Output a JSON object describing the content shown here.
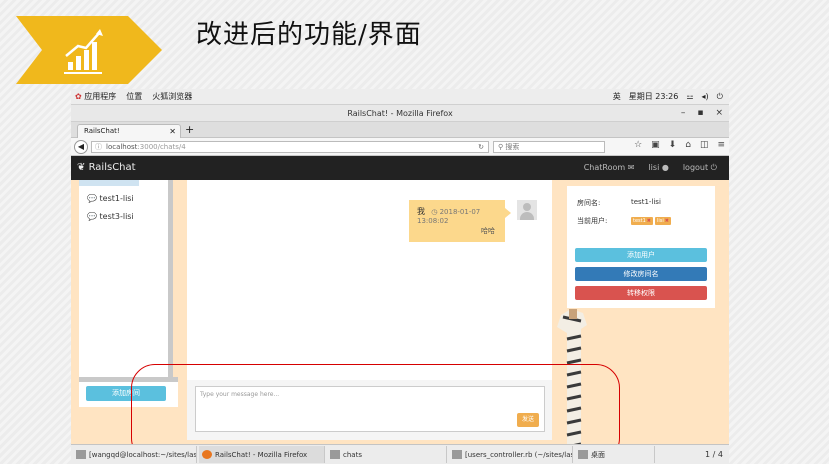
{
  "slide": {
    "title": "改进后的功能/界面",
    "accent_color": "#f0b81c",
    "badge_icon": "bar-chart-growth-icon"
  },
  "gnome_bar": {
    "applications": "应用程序",
    "places": "位置",
    "app_name": "火狐浏览器",
    "ime": "英",
    "clock": "星期日 23:26"
  },
  "browser": {
    "window_title": "RailsChat! - Mozilla Firefox",
    "tab_title": "RailsChat!",
    "url_host": "localhost",
    "url_path": ":3000/chats/4",
    "search_placeholder": "搜索",
    "minimize": "–",
    "maximize": "▪",
    "close": "×",
    "new_tab": "+"
  },
  "app": {
    "brand": "RailsChat",
    "nav_chatroom": "ChatRoom",
    "nav_user": "lisi",
    "nav_logout": "logout"
  },
  "sidebar": {
    "rooms": [
      "test1-lisi",
      "test3-lisi"
    ],
    "add_room_button": "添加房间"
  },
  "chat": {
    "message": {
      "user": "我",
      "time": "2018-01-07 13:08:02",
      "text": "哈哈"
    },
    "input_placeholder": "Type your message here...",
    "send_button": "发送"
  },
  "room_info": {
    "room_name_label": "房间名:",
    "room_name_value": "test1-lisi",
    "members_label": "当前用户:",
    "members": [
      "test1",
      "lisi"
    ],
    "add_user_button": "添加用户",
    "rename_button": "修改房间名",
    "transfer_button": "转移权限",
    "colors": {
      "add_user": "#5bc0de",
      "rename": "#337ab7",
      "transfer": "#d9534f"
    }
  },
  "taskbar": {
    "items": [
      "[wangqd@localhost:~/sites/last01/...",
      "RailsChat! - Mozilla Firefox",
      "chats",
      "[users_controller.rb (~/sites/last01/...",
      "桌面"
    ],
    "page": "1 / 4"
  }
}
